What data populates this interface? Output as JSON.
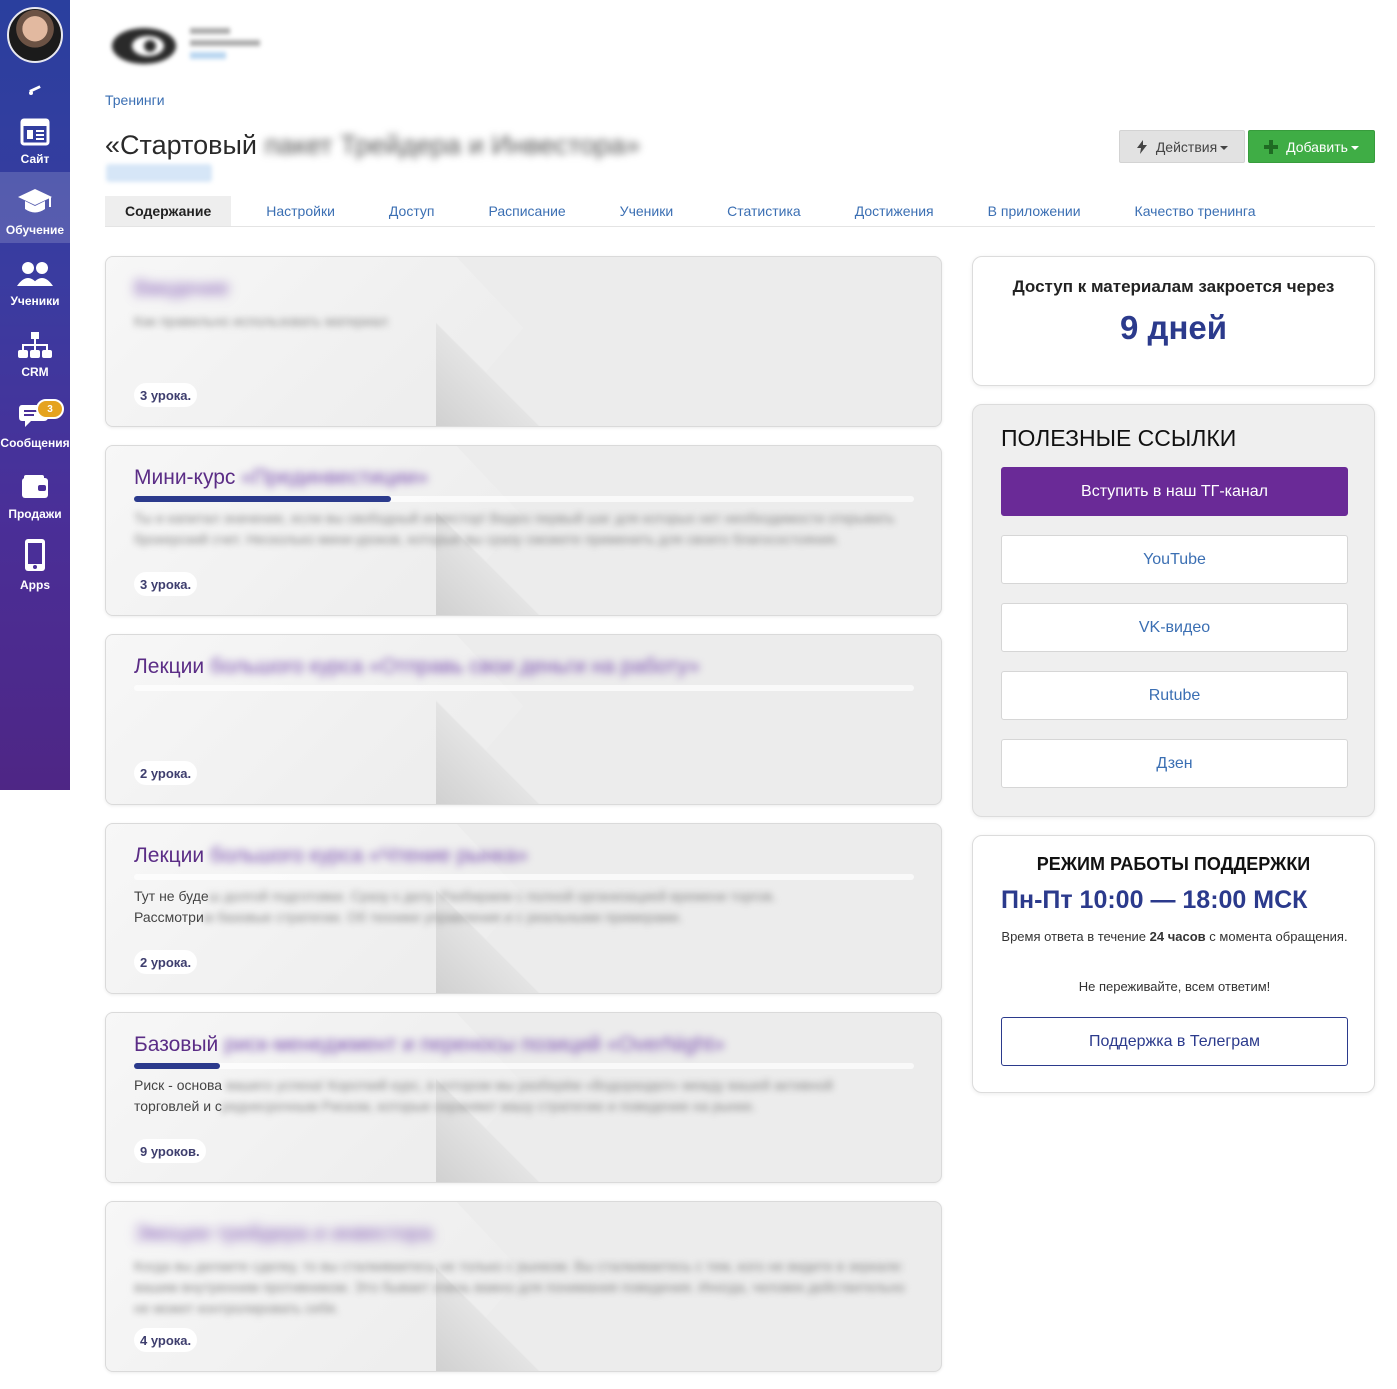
{
  "sidebar": {
    "items": [
      {
        "label": "Сайт",
        "icon": "site-icon"
      },
      {
        "label": "Обучение",
        "icon": "graduation-cap-icon",
        "active": true
      },
      {
        "label": "Ученики",
        "icon": "users-icon"
      },
      {
        "label": "CRM",
        "icon": "hierarchy-icon"
      },
      {
        "label": "Сообщения",
        "icon": "chat-icon",
        "badge": "3"
      },
      {
        "label": "Продажи",
        "icon": "wallet-icon"
      },
      {
        "label": "Apps",
        "icon": "phone-icon"
      }
    ]
  },
  "breadcrumb": "Тренинги",
  "page": {
    "title_visible": "«Стартовый",
    "title_blurred": " пакет Трейдера и Инвестора»"
  },
  "toolbar": {
    "actions_label": "Действия",
    "add_label": "Добавить"
  },
  "tabs": [
    "Содержание",
    "Настройки",
    "Доступ",
    "Расписание",
    "Ученики",
    "Статистика",
    "Достижения",
    "В приложении",
    "Качество тренинга"
  ],
  "modules": [
    {
      "title": "",
      "title_blur": "Введение",
      "desc": "",
      "desc_blur": "Как правильно использовать материал",
      "lessons": "3 урока.",
      "progress": 0
    },
    {
      "title": "Мини-курс",
      "title_blur": " «Прединвестиции»",
      "desc": "",
      "desc_blur": "Ты и капитал значение, если вы свободный инвестор! Видео первый шаг для которых нет необходимости открывать брокерский счет. Несколько мини-уроков, которые вы сразу сможете применить для своего благосостояния.",
      "lessons": "3 урока.",
      "progress": 0.33
    },
    {
      "title": "Лекции",
      "title_blur": " большого курса «Отправь свои деньги на работу»",
      "desc": "",
      "desc_blur": "",
      "lessons": "2 урока.",
      "progress": 0
    },
    {
      "title": "Лекции",
      "title_blur": " большого курса «Чтение рынка»",
      "desc": "Тут не буде",
      "desc_blur": "ш долгой подготовки. Сразу к делу. Разбираем с полной организацией времени торгов.",
      "desc2": "Рассмотри",
      "desc2_blur": "м базовые стратегии. Об технике управления и с реальными примерами.",
      "lessons": "2 урока.",
      "progress": 0
    },
    {
      "title": "Базовый",
      "title_blur": " риск-менеджмент и переносы позиций «OverNight»",
      "desc": "Риск - основа",
      "desc_blur": " вашего успеха! Короткий курс, в котором мы разберём «Водораздел» между вашей активной",
      "desc2": "торговлей и с",
      "desc2_blur": "реднесрочным Риском, которые охраняют вашу стратегию и поведение на рынке.",
      "lessons": "9 уроков.",
      "progress": 0.11
    },
    {
      "title": "",
      "title_blur": "Эмоции трейдера и инвестора",
      "desc": "",
      "desc_blur": "Когда вы делаете сделку, то вы сталкиваетесь не только с рынком. Вы сталкиваетесь с тем, кого не видите в зеркале: вашим внутренним противником. Это бывает очень важно для понимания поведения. Иногда, человек действительно не может контролировать себя.",
      "lessons": "4 урока.",
      "progress": 0
    }
  ],
  "access": {
    "text": "Доступ к материалам закроется через",
    "days": "9 дней"
  },
  "links": {
    "title": "ПОЛЕЗНЫЕ ССЫЛКИ",
    "items": [
      "Вступить в наш ТГ-канал",
      "YouTube",
      "VK-видео",
      "Rutube",
      "Дзен"
    ]
  },
  "support": {
    "title": "РЕЖИМ РАБОТЫ ПОДДЕРЖКИ",
    "hours": "Пн-Пт 10:00 — 18:00 МСК",
    "response_pre": "Время ответа в течение ",
    "response_bold": "24 часов",
    "response_post": " с момента обращения.",
    "reassure": "Не переживайте, всем ответим!",
    "button": "Поддержка в Телеграм"
  },
  "colors": {
    "accent_purple": "#6a2a97",
    "accent_navy": "#2b3a8c",
    "green": "#3fad45",
    "link": "#3b6fb3"
  }
}
